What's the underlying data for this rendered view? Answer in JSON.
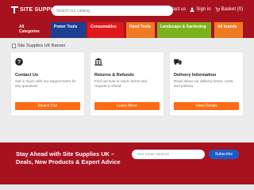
{
  "header": {
    "logo_text": "SITE SUPPLIES",
    "search_placeholder": "Search our catalog",
    "contact_label": "Contact us",
    "signin_label": "Sign in",
    "basket_label": "Basket (0)"
  },
  "nav": {
    "items": [
      {
        "label": "All Categories",
        "color": "#a8121f"
      },
      {
        "label": "Power Tools",
        "color": "#1c3f94"
      },
      {
        "label": "Consumables",
        "color": "#e0181b"
      },
      {
        "label": "Hand Tools",
        "color": "#f07a22"
      },
      {
        "label": "Landscape & Gardening",
        "color": "#7cb21c"
      },
      {
        "label": "All brands",
        "color": "#f07a22"
      }
    ]
  },
  "banner": {
    "alt_text": "Site Supplies UK Banner"
  },
  "cards": [
    {
      "icon": "question-icon",
      "title": "Contact Us",
      "desc": "Get in touch with our support team for any questions.",
      "button": "Reach Out"
    },
    {
      "icon": "bank-icon",
      "title": "Returns & Refunds",
      "desc": "Find out how to return items and request a refund.",
      "button": "Learn More"
    },
    {
      "icon": "truck-icon",
      "title": "Delivery Information",
      "desc": "Read about our delivery times, costs, and policies.",
      "button": "View Details"
    }
  ],
  "newsletter": {
    "title": "Stay Ahead with Site Supplies UK – Deals, New Products & Expert Advice",
    "email_placeholder": "Your email address",
    "button": "Subscribe"
  },
  "colors": {
    "brand_red": "#a8121f",
    "accent_orange": "#ff6a13",
    "subscribe_blue": "#1e5bc7"
  }
}
